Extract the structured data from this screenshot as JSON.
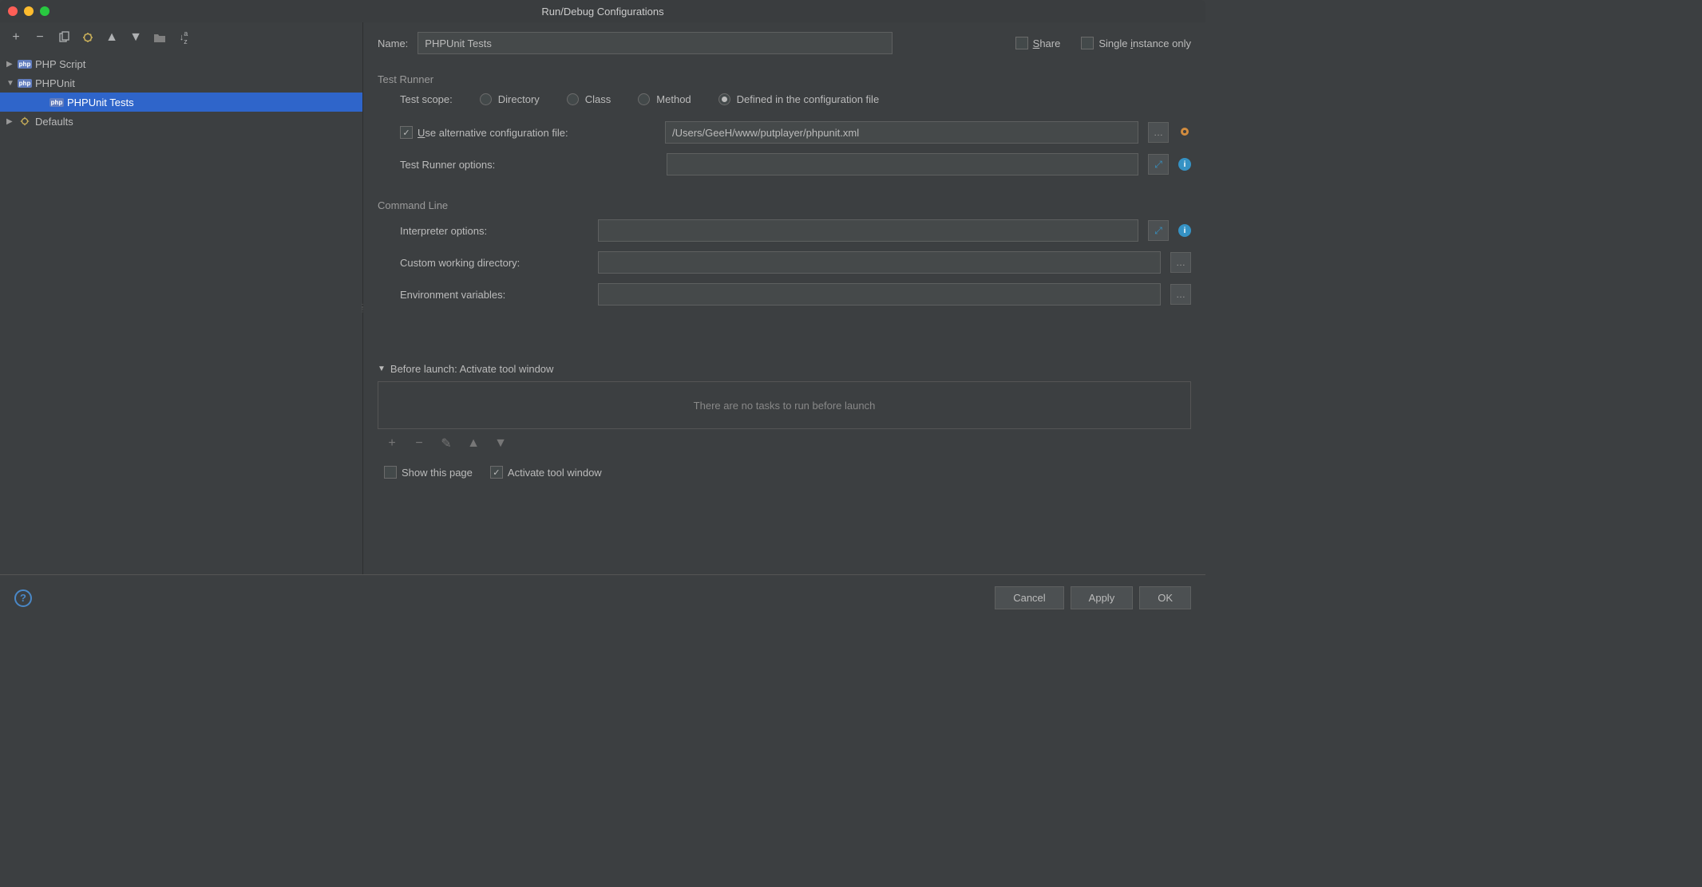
{
  "title": "Run/Debug Configurations",
  "tree": {
    "items": [
      {
        "label": "PHP Script",
        "expanded": false,
        "indent": 0,
        "iconType": "php"
      },
      {
        "label": "PHPUnit",
        "expanded": true,
        "indent": 0,
        "iconType": "php"
      },
      {
        "label": "PHPUnit Tests",
        "expanded": null,
        "indent": 1,
        "iconType": "php",
        "selected": true
      },
      {
        "label": "Defaults",
        "expanded": false,
        "indent": 0,
        "iconType": "gear"
      }
    ]
  },
  "nameLabel": "Name:",
  "nameValue": "PHPUnit Tests",
  "shareLabel": "Share",
  "shareChecked": false,
  "singleInstanceLabel": "Single instance only",
  "singleInstanceChecked": false,
  "testRunner": {
    "header": "Test Runner",
    "scopeLabel": "Test scope:",
    "scopeOptions": [
      "Directory",
      "Class",
      "Method",
      "Defined in the configuration file"
    ],
    "scopeSelected": "Defined in the configuration file",
    "useAltConfigLabel": "Use alternative configuration file:",
    "useAltConfigChecked": true,
    "altConfigPath": "/Users/GeeH/www/putplayer/phpunit.xml",
    "runnerOptionsLabel": "Test Runner options:",
    "runnerOptionsValue": ""
  },
  "commandLine": {
    "header": "Command Line",
    "interpreterLabel": "Interpreter options:",
    "interpreterValue": "",
    "workingDirLabel": "Custom working directory:",
    "workingDirValue": "",
    "envVarsLabel": "Environment variables:",
    "envVarsValue": ""
  },
  "beforeLaunch": {
    "header": "Before launch: Activate tool window",
    "emptyText": "There are no tasks to run before launch",
    "showPageLabel": "Show this page",
    "showPageChecked": false,
    "activateToolLabel": "Activate tool window",
    "activateToolChecked": true
  },
  "buttons": {
    "cancel": "Cancel",
    "apply": "Apply",
    "ok": "OK"
  }
}
